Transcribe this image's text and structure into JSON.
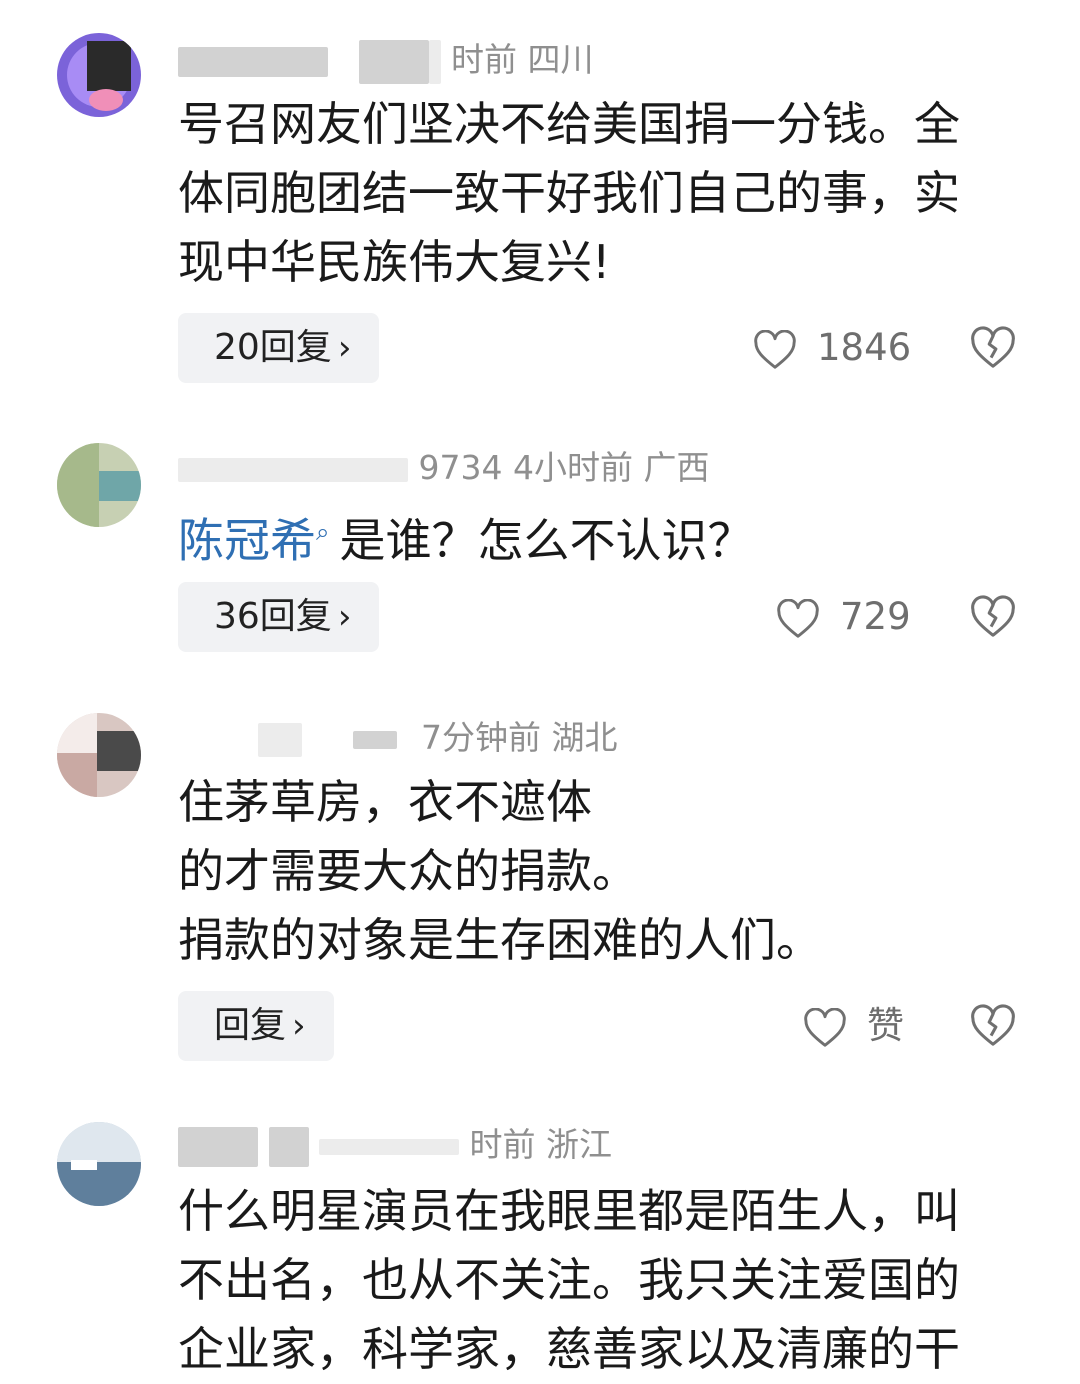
{
  "comments": [
    {
      "meta": "时前  四川",
      "lines": [
        "号召网友们坚决不给美国捐一分钱。全",
        "体同胞团结一致干好我们自己的事，实",
        "现中华民族伟大复兴!"
      ],
      "reply_label": "20回复",
      "likes": "1846"
    },
    {
      "meta": "9734  4小时前  广西",
      "mention": "陈冠希",
      "mention_icon": "search-icon",
      "text": "是谁？怎么不认识？",
      "reply_label": "36回复",
      "likes": "729"
    },
    {
      "meta": "7分钟前  湖北",
      "lines": [
        "住茅草房，衣不遮体",
        "的才需要大众的捐款。",
        "捐款的对象是生存困难的人们。"
      ],
      "reply_label": "回复",
      "likes": "赞"
    },
    {
      "meta": "时前  浙江",
      "lines": [
        "什么明星演员在我眼里都是陌生人，叫",
        "不出名，也从不关注。我只关注爱国的",
        "企业家，科学家，慈善家以及清廉的干"
      ]
    }
  ],
  "icons": {
    "chevron": "›",
    "like_icon": "heart-icon",
    "dislike_icon": "broken-heart-icon"
  },
  "colors": {
    "mention": "#2f6fb3",
    "meta": "#8f8f8f",
    "reply_bg": "#f1f2f4"
  }
}
